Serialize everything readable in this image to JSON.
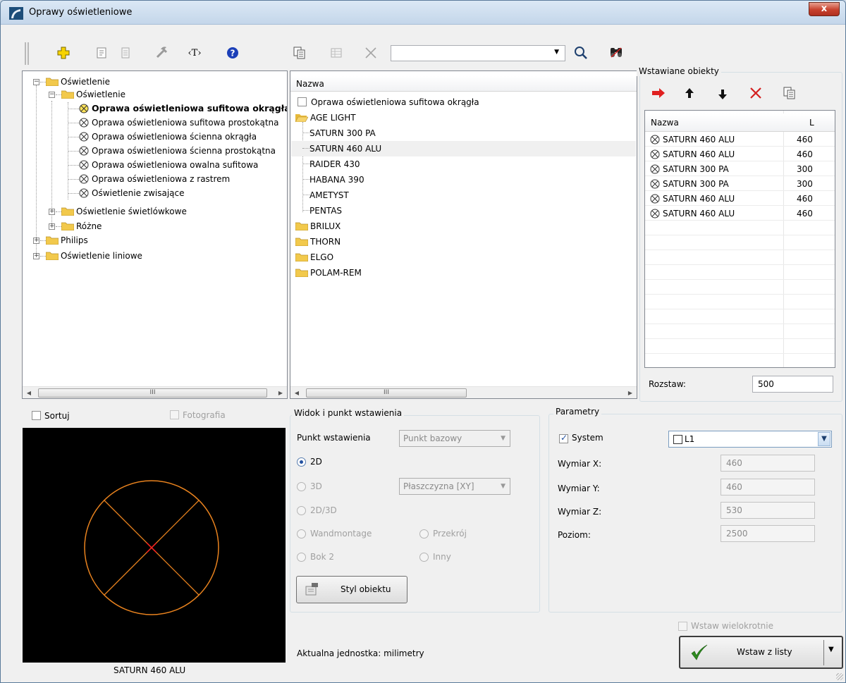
{
  "window": {
    "title": "Oprawy oświetleniowe",
    "close_label": "x"
  },
  "toolbar": {
    "search_value": ""
  },
  "tree": {
    "items": [
      {
        "label": "Oświetlenie"
      },
      {
        "label": "Oświetlenie"
      },
      {
        "label": "Oprawa oświetleniowa sufitowa okrągła"
      },
      {
        "label": "Oprawa oświetleniowa sufitowa prostokątna"
      },
      {
        "label": "Oprawa oświetleniowa ścienna okrągła"
      },
      {
        "label": "Oprawa oświetleniowa ścienna prostokątna"
      },
      {
        "label": "Oprawa oświetleniowa owalna sufitowa"
      },
      {
        "label": "Oprawa oświetleniowa z rastrem"
      },
      {
        "label": "Oświetlenie zwisające"
      },
      {
        "label": "Oświetlenie świetlówkowe"
      },
      {
        "label": "Różne"
      },
      {
        "label": "Philips"
      },
      {
        "label": "Oświetlenie liniowe"
      }
    ]
  },
  "catalog": {
    "header": "Nazwa",
    "items": [
      "Oprawa oświetleniowa sufitowa okrągła",
      "AGE LIGHT",
      "SATURN 300 PA",
      "SATURN 460 ALU",
      "RAIDER 430",
      "HABANA 390",
      "AMETYST",
      "PENTAS",
      "BRILUX",
      "THORN",
      "ELGO",
      "POLAM-REM"
    ]
  },
  "inserted": {
    "title": "Wstawiane obiekty",
    "col_name": "Nazwa",
    "col_l": "L",
    "rows": [
      {
        "name": "SATURN 460 ALU",
        "l": "460"
      },
      {
        "name": "SATURN 460 ALU",
        "l": "460"
      },
      {
        "name": "SATURN 300 PA",
        "l": "300"
      },
      {
        "name": "SATURN 300 PA",
        "l": "300"
      },
      {
        "name": "SATURN 460 ALU",
        "l": "460"
      },
      {
        "name": "SATURN 460 ALU",
        "l": "460"
      }
    ],
    "spacing_label": "Rozstaw:",
    "spacing_value": "500"
  },
  "preview": {
    "sort_label": "Sortuj",
    "photo_label": "Fotografia",
    "caption": "SATURN 460 ALU",
    "colors": {
      "circle": "#e8821e",
      "center": "#ff2020",
      "background": "#000000"
    }
  },
  "view": {
    "title": "Widok i punkt wstawienia",
    "insertion_label": "Punkt wstawienia",
    "insertion_value": "Punkt bazowy",
    "opt_2d": "2D",
    "opt_3d": "3D",
    "plane_value": "Płaszczyzna  [XY]",
    "opt_2d3d": "2D/3D",
    "opt_wand": "Wandmontage",
    "opt_przekroj": "Przekrój",
    "opt_bok2": "Bok 2",
    "opt_inny": "Inny",
    "style_button": "Styl obiektu"
  },
  "params": {
    "title": "Parametry",
    "system_label": "System",
    "layer_value": "L1",
    "x_label": "Wymiar X:",
    "x_value": "460",
    "y_label": "Wymiar Y:",
    "y_value": "460",
    "z_label": "Wymiar Z:",
    "z_value": "530",
    "level_label": "Poziom:",
    "level_value": "2500"
  },
  "footer": {
    "unit_text": "Aktualna jednostka: milimetry",
    "multi_label": "Wstaw wielokrotnie",
    "insert_button": "Wstaw z listy"
  }
}
